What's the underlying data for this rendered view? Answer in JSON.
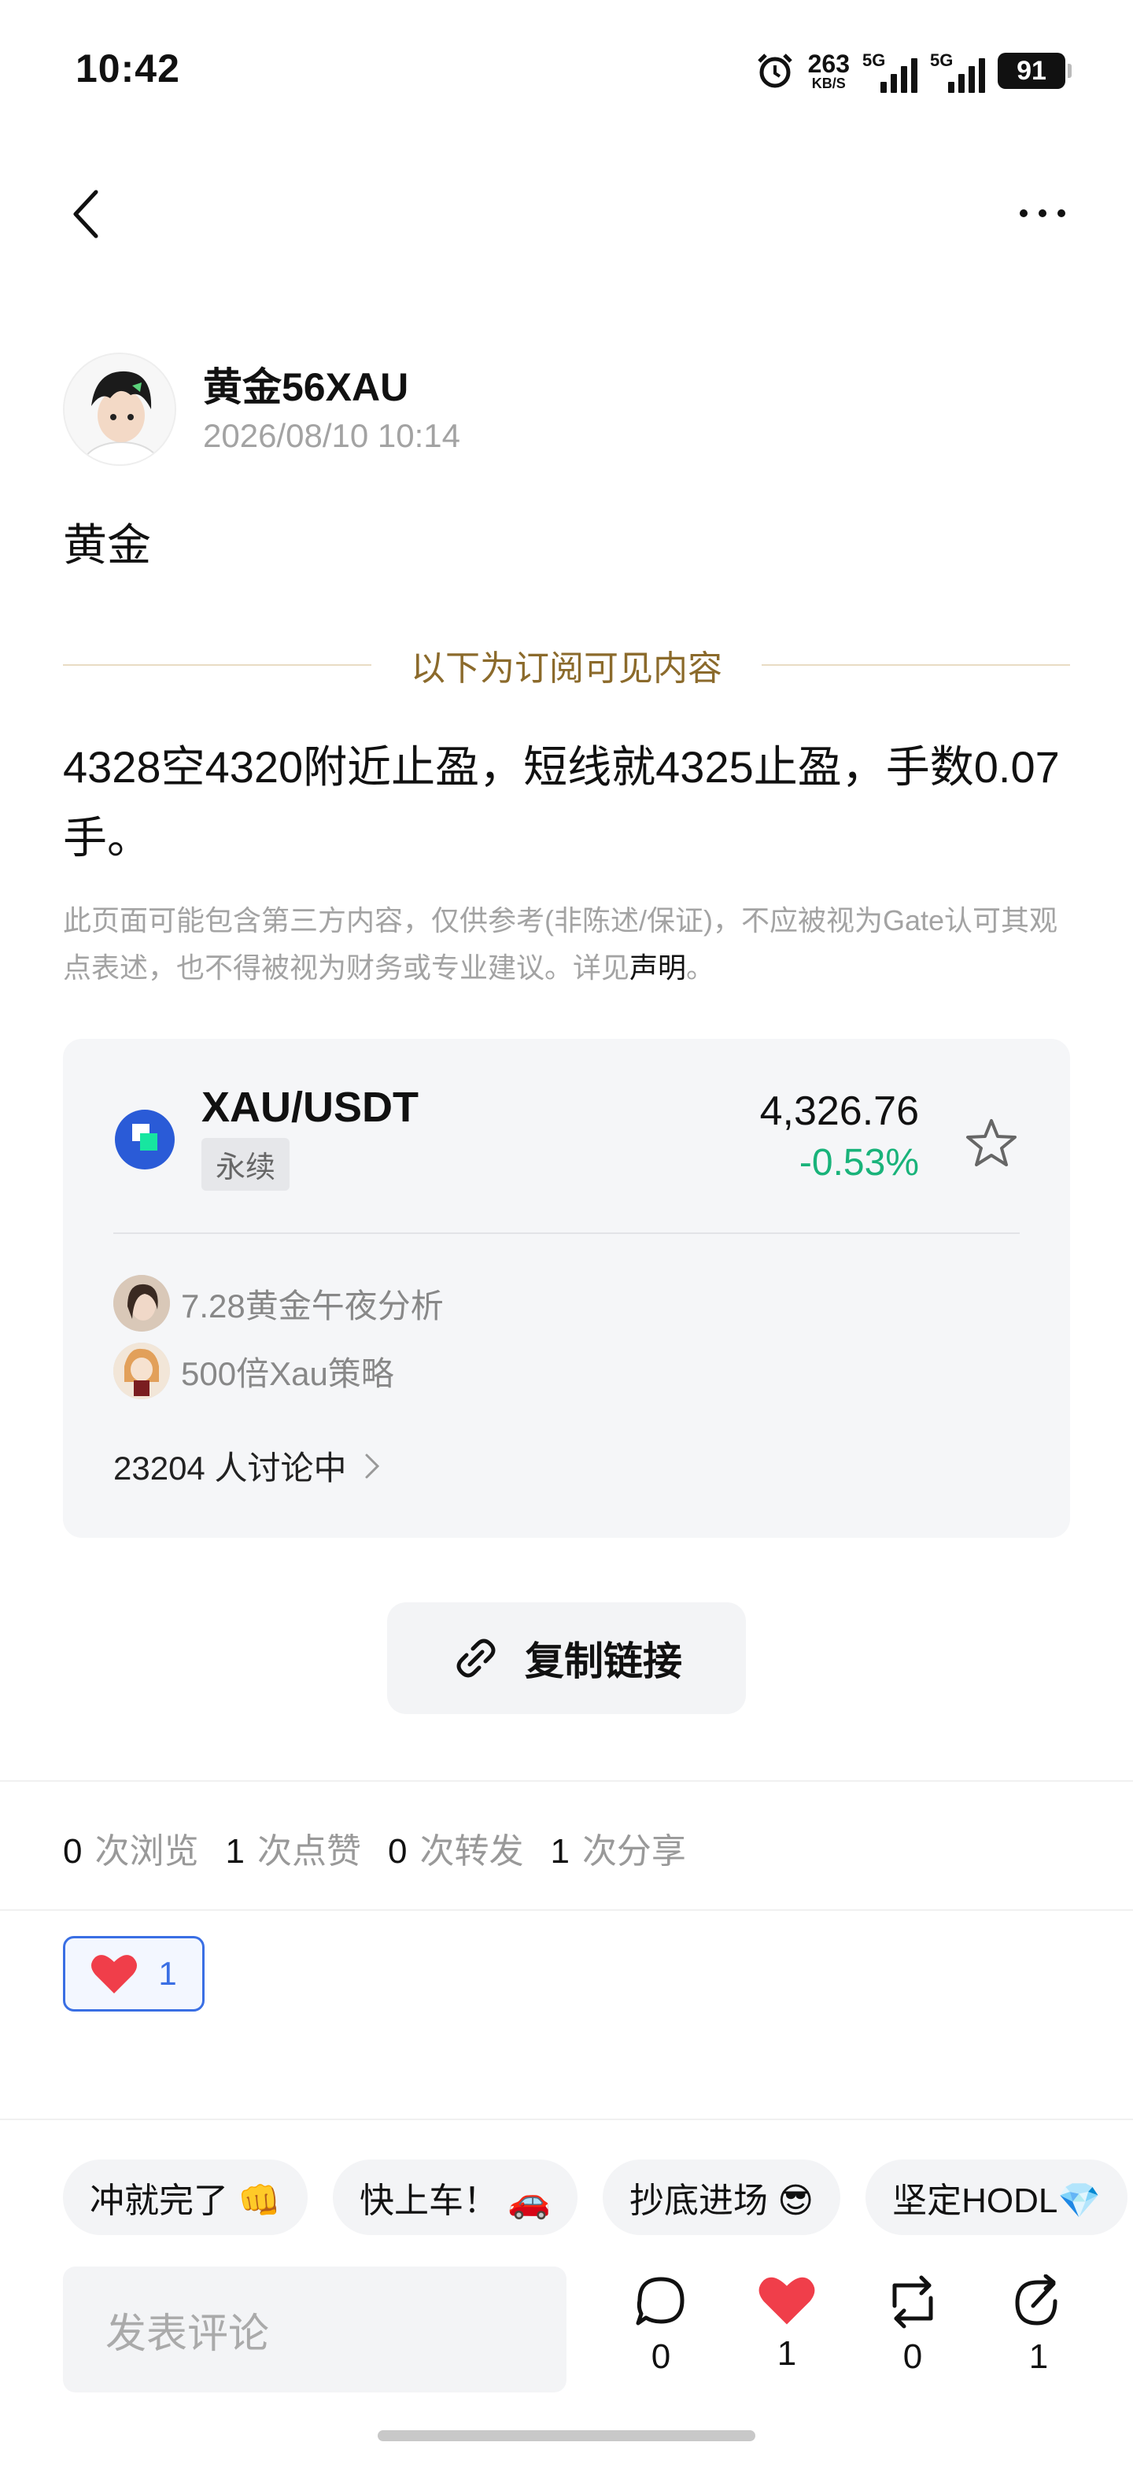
{
  "status_bar": {
    "time": "10:42",
    "net_speed": "263",
    "net_unit": "KB/S",
    "signal1_label": "5G",
    "signal2_label": "5G",
    "battery": "91"
  },
  "author": {
    "name": "黄金56XAU",
    "timestamp": "2026/08/10 10:14"
  },
  "post": {
    "title": "黄金",
    "subscription_divider": "以下为订阅可见内容",
    "body": "4328空4320附近止盈，短线就4325止盈，手数0.07手。",
    "disclaimer": "此页面可能包含第三方内容，仅供参考(非陈述/保证)，不应被视为Gate认可其观点表述，也不得被视为财务或专业建议。详见",
    "disclaimer_link": "声明",
    "disclaimer_end": "。"
  },
  "market_card": {
    "pair": "XAU/USDT",
    "tag": "永续",
    "price": "4,326.76",
    "change": "-0.53%",
    "change_color": "#19b37a",
    "topics": [
      "7.28黄金午夜分析",
      "500倍Xau策略"
    ],
    "discussion": "23204 人讨论中"
  },
  "copy_link": {
    "label": "复制链接"
  },
  "stats": [
    {
      "count": "0",
      "label": "次浏览"
    },
    {
      "count": "1",
      "label": "次点赞"
    },
    {
      "count": "0",
      "label": "次转发"
    },
    {
      "count": "1",
      "label": "次分享"
    }
  ],
  "reaction": {
    "icon": "heart-icon",
    "count": "1"
  },
  "quick_replies": [
    "冲就完了 👊",
    "快上车！ 🚗",
    "抄底进场 😎",
    "坚定HODL💎"
  ],
  "comment_box": {
    "placeholder": "发表评论"
  },
  "actions": [
    {
      "icon": "comment-icon",
      "count": "0"
    },
    {
      "icon": "like-icon",
      "count": "1"
    },
    {
      "icon": "repost-icon",
      "count": "0"
    },
    {
      "icon": "share-icon",
      "count": "1"
    }
  ],
  "colors": {
    "accent_blue": "#3a6fe4",
    "gold": "#8b6a2b",
    "like_red": "#f03e4a"
  }
}
